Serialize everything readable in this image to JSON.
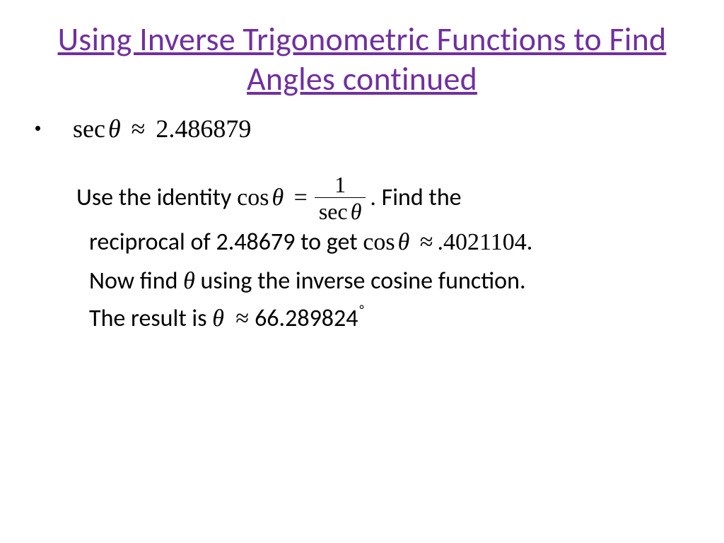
{
  "title": "Using Inverse Trigonometric Functions to Find Angles continued",
  "bullet": {
    "sec_label": "sec",
    "theta": "θ",
    "approx": "≈",
    "value": "2.486879"
  },
  "para1": {
    "lead": "Use the identity ",
    "cos_label": "cos",
    "theta": "θ",
    "eq": "=",
    "frac_num": "1",
    "frac_den_sec": "sec",
    "frac_den_theta": "θ",
    "period": ".",
    "tail1": " Find the",
    "line2a": "reciprocal of 2.48679 to get ",
    "cos2": "cos",
    "theta2": "θ",
    "approx": "≈",
    "val2": ".4021104",
    "period2": "."
  },
  "para2": {
    "a": "Now find ",
    "theta": "θ",
    "b": " using the inverse cosine function.",
    "c": "The result is ",
    "theta2": "θ",
    "approx": "≈",
    "val": "66.289824",
    "deg": "°"
  }
}
